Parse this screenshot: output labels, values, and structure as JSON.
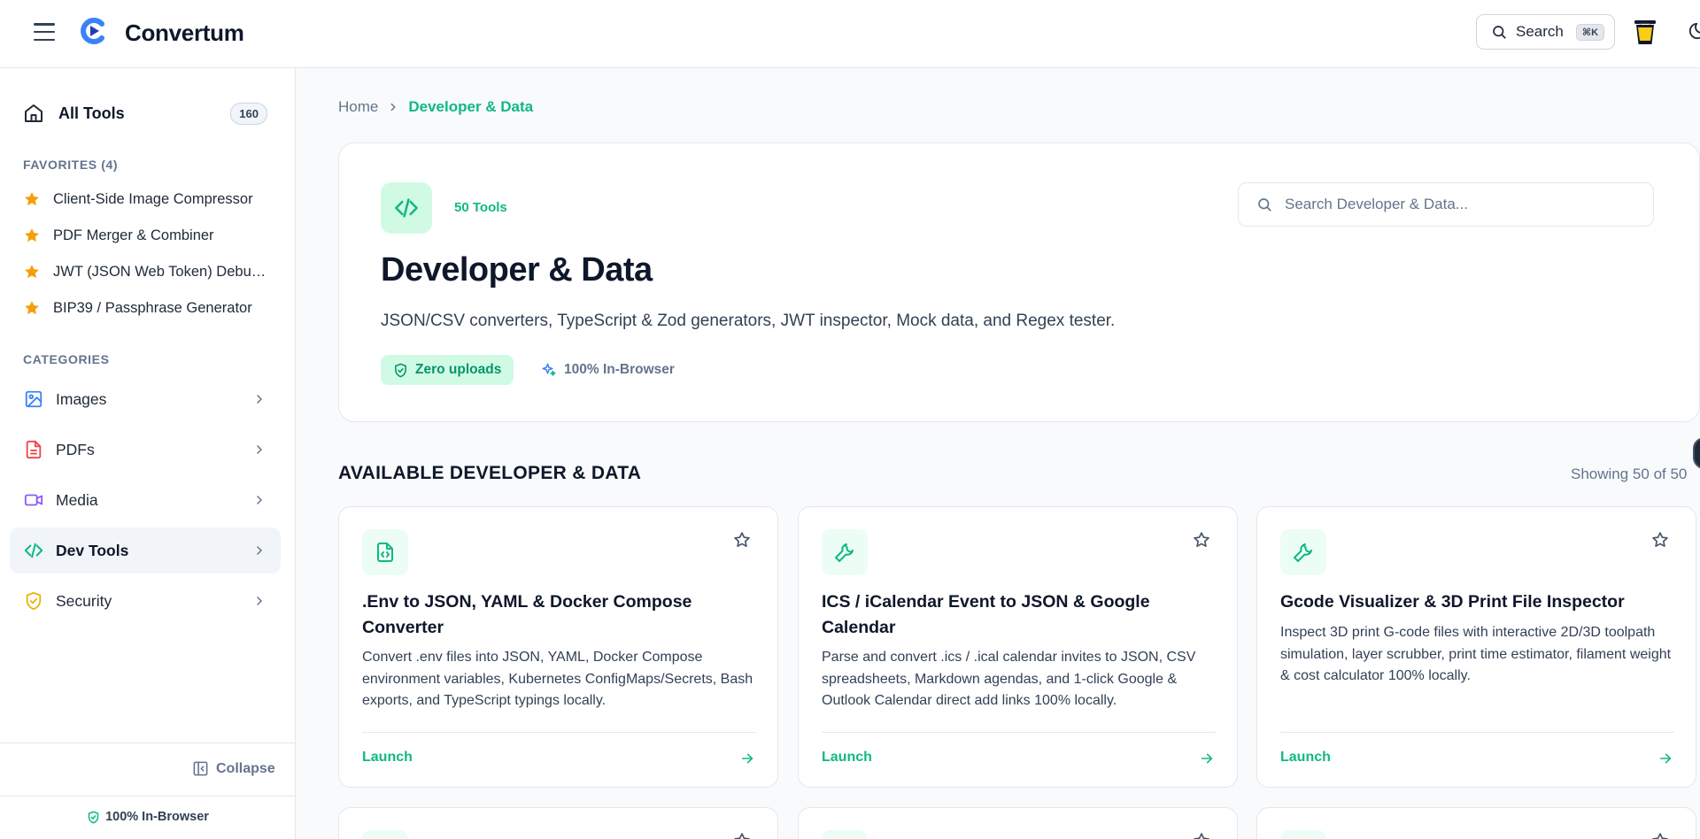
{
  "header": {
    "app_name": "Convertum",
    "search_label": "Search",
    "search_shortcut": "⌘K"
  },
  "sidebar": {
    "all_tools_label": "All Tools",
    "all_tools_count": "160",
    "favorites_heading": "FAVORITES (4)",
    "favorites": [
      {
        "label": "Client-Side Image Compressor"
      },
      {
        "label": "PDF Merger & Combiner"
      },
      {
        "label": "JWT (JSON Web Token) Debugger"
      },
      {
        "label": "BIP39 / Passphrase Generator"
      }
    ],
    "categories_heading": "CATEGORIES",
    "categories": [
      {
        "label": "Images",
        "icon": "image-icon",
        "color": "#3b82f6"
      },
      {
        "label": "PDFs",
        "icon": "file-text-icon",
        "color": "#ef4444"
      },
      {
        "label": "Media",
        "icon": "video-icon",
        "color": "#8b5cf6"
      },
      {
        "label": "Dev Tools",
        "icon": "code-icon",
        "color": "#10b981",
        "active": true
      },
      {
        "label": "Security",
        "icon": "shield-icon",
        "color": "#eab308"
      }
    ],
    "collapse_label": "Collapse",
    "footer_label": "100% In-Browser"
  },
  "breadcrumb": {
    "home": "Home",
    "current": "Developer & Data"
  },
  "hero": {
    "tool_count": "50 Tools",
    "title": "Developer & Data",
    "description": "JSON/CSV converters, TypeScript & Zod generators, JWT inspector, Mock data, and Regex tester.",
    "badge_zero": "Zero uploads",
    "badge_browser": "100% In-Browser",
    "search_placeholder": "Search Developer & Data..."
  },
  "listing": {
    "section_title": "AVAILABLE DEVELOPER & DATA",
    "showing": "Showing 50 of 50"
  },
  "cards": [
    {
      "icon": "file-code-icon",
      "title": ".Env to JSON, YAML & Docker Compose Converter",
      "description": "Convert .env files into JSON, YAML, Docker Compose environment variables, Kubernetes ConfigMaps/Secrets, Bash exports, and TypeScript typings locally.",
      "launch": "Launch"
    },
    {
      "icon": "wrench-icon",
      "title": "ICS / iCalendar Event to JSON & Google Calendar",
      "description": "Parse and convert .ics / .ical calendar invites to JSON, CSV spreadsheets, Markdown agendas, and 1-click Google & Outlook Calendar direct add links 100% locally.",
      "launch": "Launch"
    },
    {
      "icon": "wrench-icon",
      "title": "Gcode Visualizer & 3D Print File Inspector",
      "description": "Inspect 3D print G-code files with interactive 2D/3D toolpath simulation, layer scrubber, print time estimator, filament weight & cost calculator 100% locally.",
      "launch": "Launch"
    }
  ],
  "colors": {
    "accent": "#10b981",
    "accent_bg": "#d1fae5",
    "star": "#f59e0b"
  }
}
